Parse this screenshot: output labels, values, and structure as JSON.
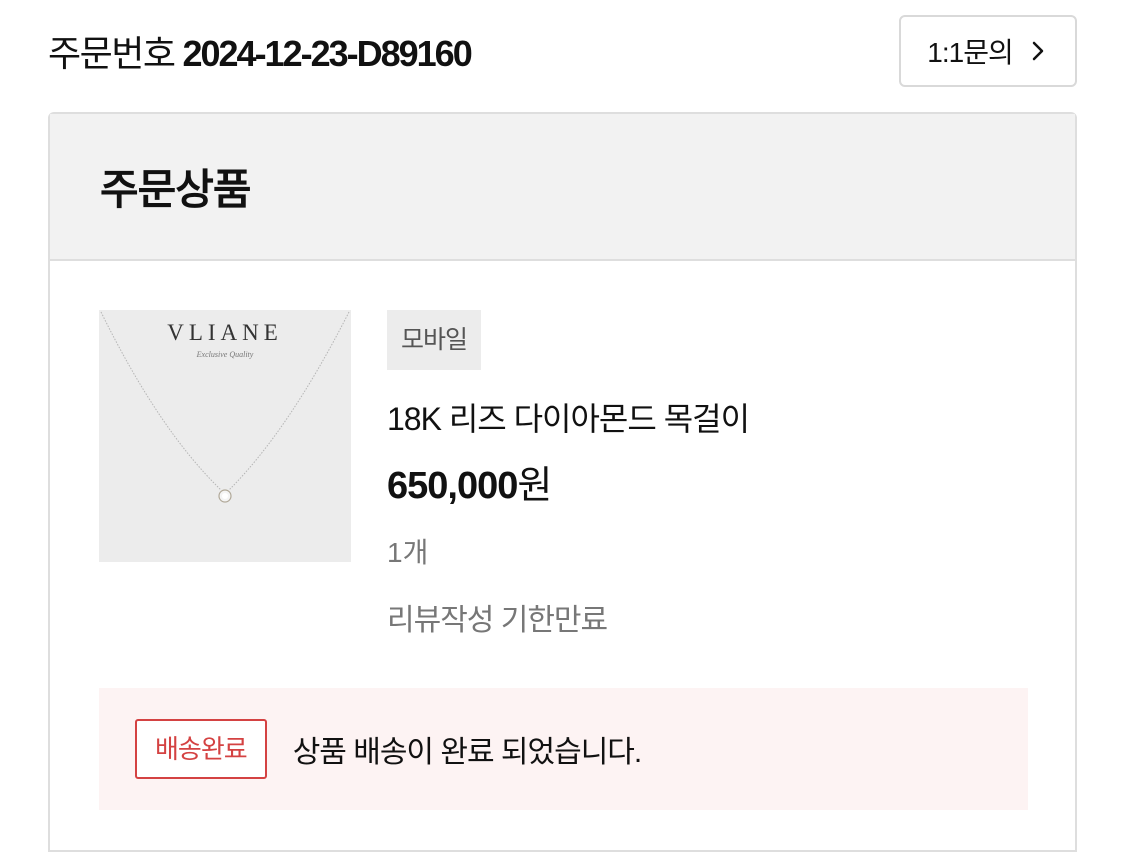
{
  "order": {
    "label": "주문번호",
    "number": "2024-12-23-D89160"
  },
  "inquiry_button": {
    "label": "1:1문의",
    "icon": "chevron-right-icon"
  },
  "section": {
    "title": "주문상품"
  },
  "product": {
    "image_brand": "VLIANE",
    "image_tagline": "Exclusive Quality",
    "channel_badge": "모바일",
    "name": "18K 리즈 다이아몬드 목걸이",
    "price": "650,000",
    "currency": "원",
    "quantity": "1개",
    "review_status": "리뷰작성 기한만료"
  },
  "delivery": {
    "status_badge": "배송완료",
    "message": "상품 배송이 완료 되었습니다."
  },
  "colors": {
    "status_red": "#d44242",
    "notice_bg": "#fdf3f3",
    "header_bg": "#f2f2f2"
  }
}
